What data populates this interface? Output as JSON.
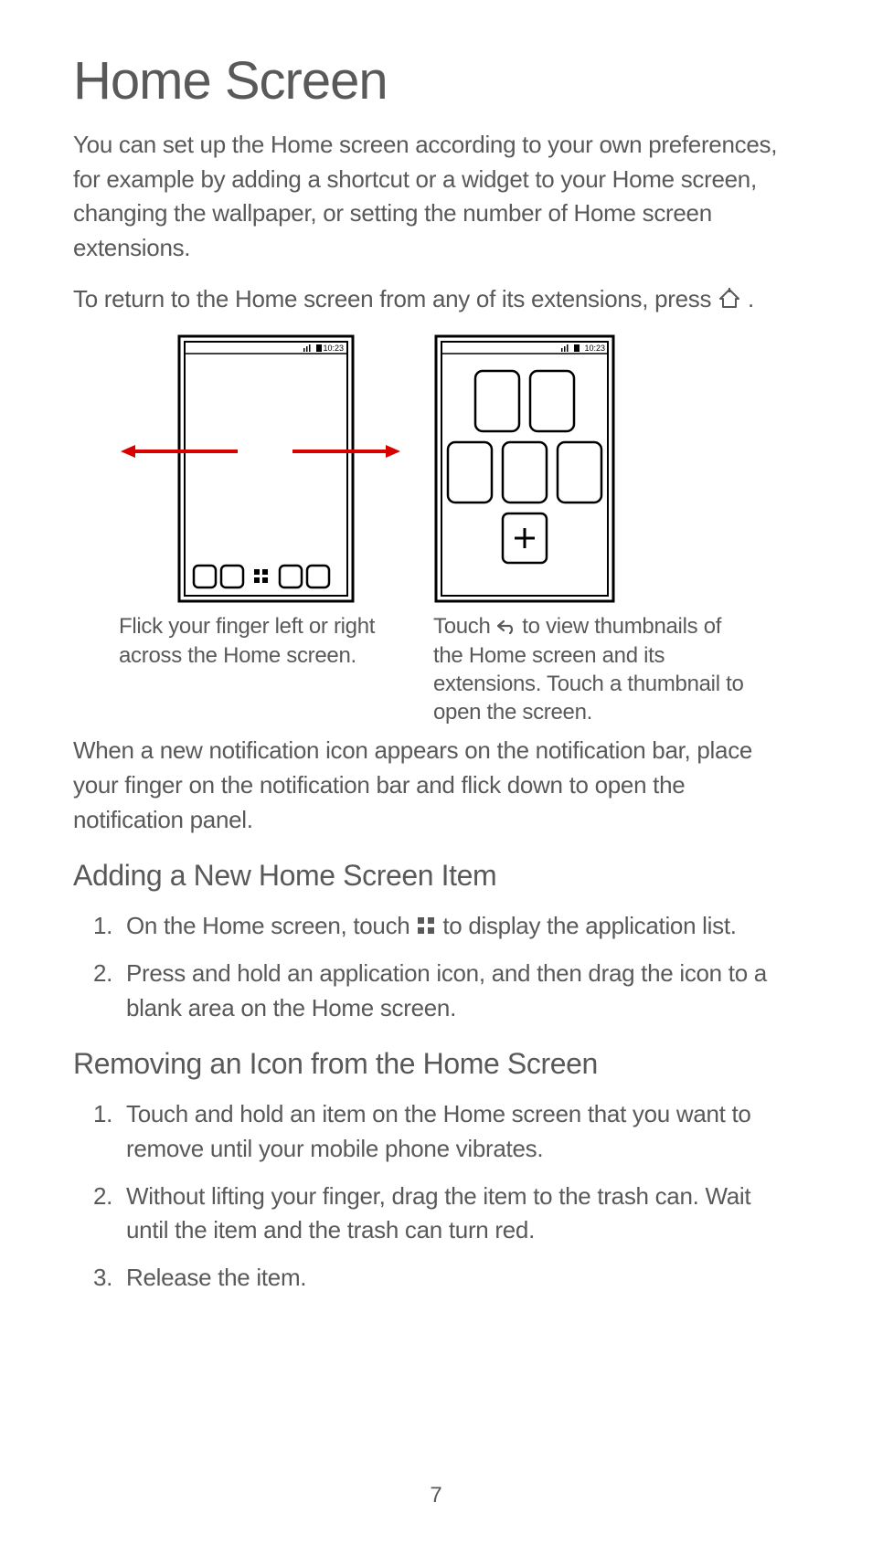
{
  "title": "Home Screen",
  "intro_p1": "You can set up the Home screen according to your own preferences, for example by adding a shortcut or a widget to your Home screen, changing the wallpaper, or setting the number of Home screen extensions.",
  "intro_p2_pre": "To return to the Home screen from any of its extensions, press ",
  "intro_p2_post": " .",
  "status_time": "10:23",
  "fig1_caption": "Flick your finger left or right across the Home screen.",
  "fig2_caption_pre": "Touch ",
  "fig2_caption_post": " to view thumbnails of the Home screen and its extensions. Touch a thumbnail to open the screen.",
  "notif_p": "When a new notification icon appears on the notification bar, place your finger on the notification bar and flick down to open the notification panel.",
  "section_add": "Adding a New Home Screen Item",
  "add_step1_pre": "On the Home screen, touch ",
  "add_step1_post": " to display the application list.",
  "add_step2": "Press and hold an application icon, and then drag the icon to a blank area on the Home screen.",
  "section_remove": "Removing an Icon from the Home Screen",
  "remove_step1": "Touch and hold an item on the Home screen that you want to remove until your mobile phone vibrates.",
  "remove_step2": "Without lifting your finger, drag the item to the trash can. Wait until the item and the trash can turn red.",
  "remove_step3": "Release the item.",
  "page_number": "7",
  "icons": {
    "home": "home-icon",
    "back": "back-icon",
    "apps": "apps-icon"
  }
}
